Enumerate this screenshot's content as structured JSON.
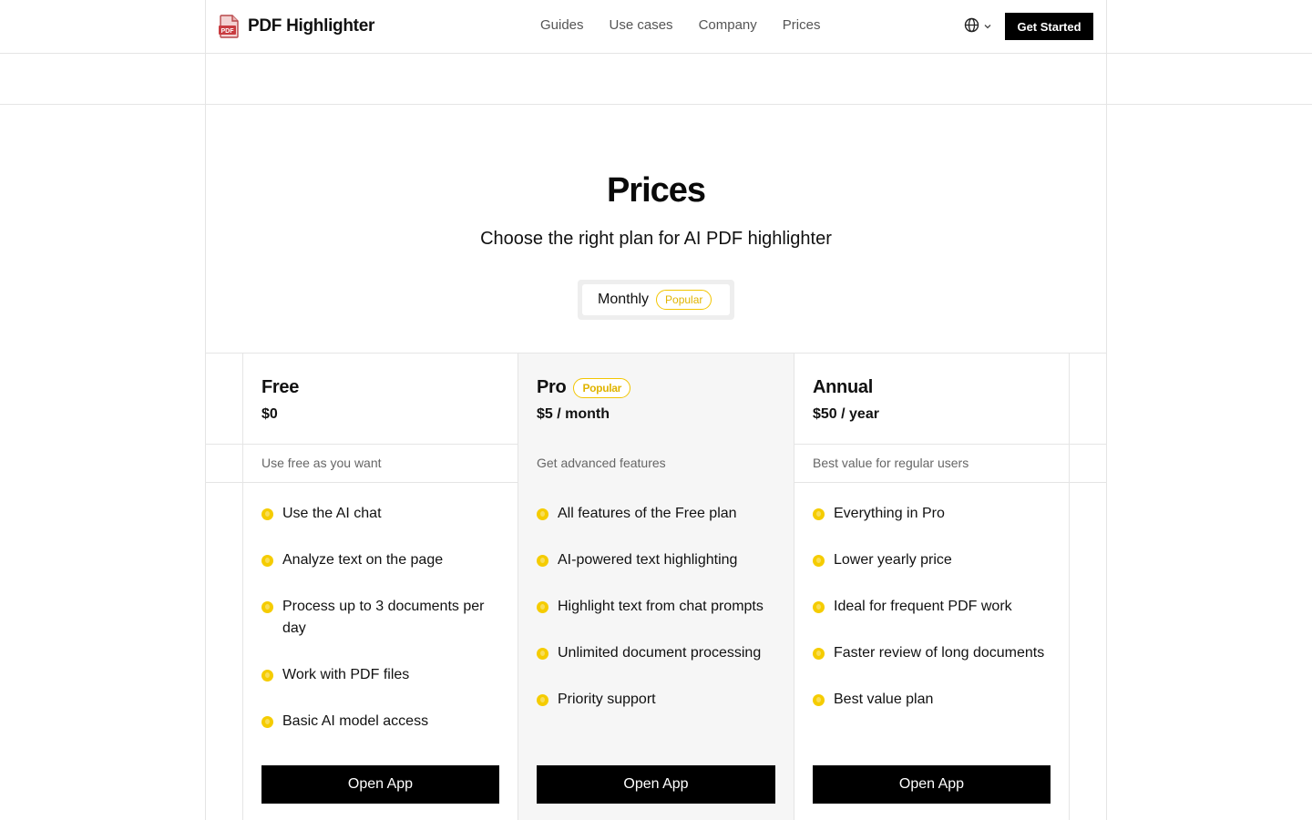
{
  "header": {
    "logo_text": "PDF Highlighter",
    "logo_icon_label": "PDF",
    "nav": [
      "Guides",
      "Use cases",
      "Company",
      "Prices"
    ],
    "cta_label": "Get Started"
  },
  "hero": {
    "title": "Prices",
    "subtitle": "Choose the right plan for AI PDF highlighter",
    "toggle_label": "Monthly",
    "toggle_badge": "Popular"
  },
  "plans": [
    {
      "name": "Free",
      "badge": "",
      "price": "$0",
      "description": "Use free as you want",
      "features": [
        "Use the AI chat",
        "Analyze text on the page",
        "Process up to 3 documents per day",
        "Work with PDF files",
        "Basic AI model access"
      ],
      "button": "Open App"
    },
    {
      "name": "Pro",
      "badge": "Popular",
      "price": "$5 / month",
      "description": "Get advanced features",
      "features": [
        "All features of the Free plan",
        "AI-powered text highlighting",
        "Highlight text from chat prompts",
        "Unlimited document processing",
        "Priority support"
      ],
      "button": "Open App"
    },
    {
      "name": "Annual",
      "badge": "",
      "price": "$50 / year",
      "description": "Best value for regular users",
      "features": [
        "Everything in Pro",
        "Lower yearly price",
        "Ideal for frequent PDF work",
        "Faster review of long documents",
        "Best value plan"
      ],
      "button": "Open App"
    }
  ],
  "colors": {
    "accent": "#f5cc00",
    "button": "#000000",
    "highlight_column": "#f6f6f6",
    "border": "#e5e5e5"
  }
}
